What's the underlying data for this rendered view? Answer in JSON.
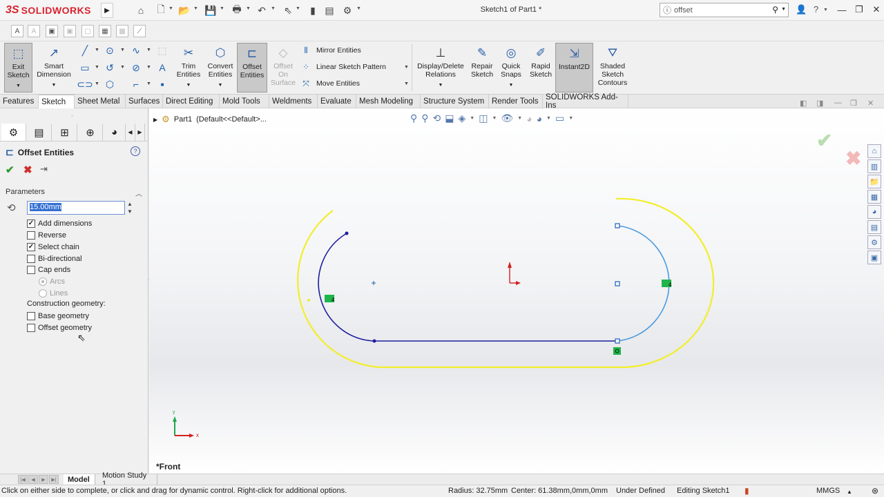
{
  "titlebar": {
    "brand_ds": "3S",
    "brand_name": "SOLIDWORKS",
    "document_title": "Sketch1 of Part1 *",
    "search_value": "offset"
  },
  "ribbon": {
    "exit_sketch": [
      "Exit",
      "Sketch"
    ],
    "smart_dimension": [
      "Smart",
      "Dimension"
    ],
    "trim_entities": [
      "Trim",
      "Entities"
    ],
    "convert_entities": [
      "Convert",
      "Entities"
    ],
    "offset_entities": [
      "Offset",
      "Entities"
    ],
    "offset_on_surface": [
      "Offset",
      "On",
      "Surface"
    ],
    "mirror_entities": "Mirror Entities",
    "linear_sketch_pattern": "Linear Sketch Pattern",
    "move_entities": "Move Entities",
    "display_delete_relations": [
      "Display/Delete",
      "Relations"
    ],
    "repair_sketch": [
      "Repair",
      "Sketch"
    ],
    "quick_snaps": [
      "Quick",
      "Snaps"
    ],
    "rapid_sketch": [
      "Rapid",
      "Sketch"
    ],
    "instant2d": "Instant2D",
    "shaded_sketch_contours": [
      "Shaded",
      "Sketch",
      "Contours"
    ]
  },
  "tabs": [
    "Features",
    "Sketch",
    "Sheet Metal",
    "Surfaces",
    "Direct Editing",
    "Mold Tools",
    "Weldments",
    "Evaluate",
    "Mesh Modeling",
    "Structure System",
    "Render Tools",
    "SOLIDWORKS Add-Ins"
  ],
  "active_tab": "Sketch",
  "property_manager": {
    "title": "Offset Entities",
    "parameters_label": "Parameters",
    "distance_value": "15.00mm",
    "checkboxes": [
      {
        "label": "Add dimensions",
        "checked": true
      },
      {
        "label": "Reverse",
        "checked": false
      },
      {
        "label": "Select chain",
        "checked": true
      },
      {
        "label": "Bi-directional",
        "checked": false
      },
      {
        "label": "Cap ends",
        "checked": false
      }
    ],
    "cap_options": [
      {
        "label": "Arcs",
        "selected": true
      },
      {
        "label": "Lines",
        "selected": false
      }
    ],
    "construction_label": "Construction geometry:",
    "construction_checkboxes": [
      {
        "label": "Base geometry",
        "checked": false
      },
      {
        "label": "Offset geometry",
        "checked": false
      }
    ]
  },
  "graphics": {
    "tree_item": "Part1",
    "tree_config": "(Default<<Default>...",
    "view_label": "*Front",
    "axis_x": "x",
    "axis_y": "y",
    "relation_marker": "4",
    "colors": {
      "original_sketch": "#1c1ca0",
      "selected_chain": "#4a9ae0",
      "offset_preview": "#f2ee2a",
      "origin_red": "#d42020"
    }
  },
  "bottom_tabs": [
    "Model",
    "Motion Study 1"
  ],
  "active_bottom_tab": "Model",
  "status": {
    "hint": "Click on either side to complete, or click and drag for dynamic control.  Right-click for additional options.",
    "radius": "Radius: 32.75mm",
    "center": "Center: 61.38mm,0mm,0mm",
    "definition": "Under Defined",
    "editing": "Editing Sketch1",
    "units": "MMGS"
  }
}
